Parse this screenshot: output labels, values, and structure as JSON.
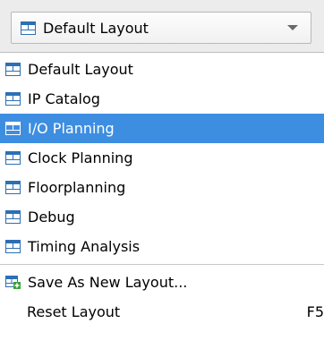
{
  "combo": {
    "selected": "Default Layout",
    "icon": "layout-icon"
  },
  "menu": {
    "items": [
      {
        "label": "Default Layout",
        "icon": "layout-icon"
      },
      {
        "label": "IP Catalog",
        "icon": "layout-icon"
      },
      {
        "label": "I/O Planning",
        "icon": "layout-icon",
        "selected": true
      },
      {
        "label": "Clock Planning",
        "icon": "layout-icon"
      },
      {
        "label": "Floorplanning",
        "icon": "layout-icon"
      },
      {
        "label": "Debug",
        "icon": "layout-icon"
      },
      {
        "label": "Timing Analysis",
        "icon": "layout-icon"
      }
    ],
    "save_new": {
      "label": "Save As New Layout...",
      "icon": "save-layout-icon"
    },
    "reset": {
      "label": "Reset Layout",
      "shortcut": "F5"
    }
  },
  "colors": {
    "highlight": "#3d8ee1",
    "icon_blue": "#2d6fb3",
    "icon_add": "#3aa23a"
  }
}
